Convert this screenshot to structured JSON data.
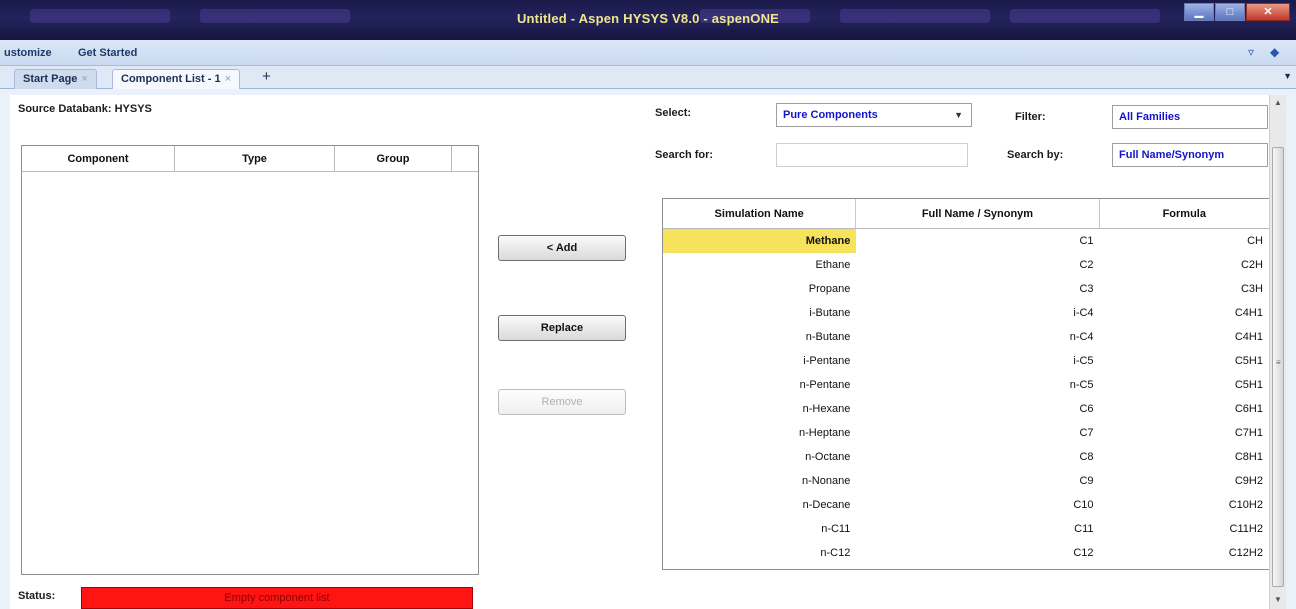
{
  "window": {
    "title": "Untitled - Aspen HYSYS V8.0 - aspenONE",
    "controls": [
      "minimize-icon",
      "maximize-icon",
      "close-icon"
    ]
  },
  "ribbon": {
    "items": [
      {
        "label": "ustomize"
      },
      {
        "label": "Get Started"
      }
    ],
    "icons": [
      "collapse-ribbon-icon",
      "help-icon"
    ]
  },
  "tabs": [
    {
      "label": "Start Page",
      "active": false
    },
    {
      "label": "Component List - 1",
      "active": true
    }
  ],
  "tab_add": "+",
  "source_databank": "Source Databank: HYSYS",
  "left_grid": {
    "columns": [
      "Component",
      "Type",
      "Group"
    ],
    "rows": []
  },
  "buttons": {
    "add": "< Add",
    "replace": "Replace",
    "remove": "Remove"
  },
  "select": {
    "label": "Select:",
    "value": "Pure Components"
  },
  "filter": {
    "label": "Filter:",
    "value": "All Families"
  },
  "search_for": {
    "label": "Search for:",
    "value": ""
  },
  "search_by": {
    "label": "Search by:",
    "value": "Full Name/Synonym"
  },
  "right_grid": {
    "columns": [
      "Simulation Name",
      "Full Name / Synonym",
      "Formula"
    ],
    "rows": [
      {
        "name": "Methane",
        "synonym": "C1",
        "formula": "CH",
        "selected": true
      },
      {
        "name": "Ethane",
        "synonym": "C2",
        "formula": "C2H"
      },
      {
        "name": "Propane",
        "synonym": "C3",
        "formula": "C3H"
      },
      {
        "name": "i-Butane",
        "synonym": "i-C4",
        "formula": "C4H1"
      },
      {
        "name": "n-Butane",
        "synonym": "n-C4",
        "formula": "C4H1"
      },
      {
        "name": "i-Pentane",
        "synonym": "i-C5",
        "formula": "C5H1"
      },
      {
        "name": "n-Pentane",
        "synonym": "n-C5",
        "formula": "C5H1"
      },
      {
        "name": "n-Hexane",
        "synonym": "C6",
        "formula": "C6H1"
      },
      {
        "name": "n-Heptane",
        "synonym": "C7",
        "formula": "C7H1"
      },
      {
        "name": "n-Octane",
        "synonym": "C8",
        "formula": "C8H1"
      },
      {
        "name": "n-Nonane",
        "synonym": "C9",
        "formula": "C9H2"
      },
      {
        "name": "n-Decane",
        "synonym": "C10",
        "formula": "C10H2"
      },
      {
        "name": "n-C11",
        "synonym": "C11",
        "formula": "C11H2"
      },
      {
        "name": "n-C12",
        "synonym": "C12",
        "formula": "C12H2"
      }
    ]
  },
  "status": {
    "label": "Status:",
    "message": "Empty component list",
    "color": "#ff1414"
  },
  "colors": {
    "highlight": "#f6e35b",
    "combo_text": "#1414c8",
    "titlebar": "#1a1a4a"
  }
}
